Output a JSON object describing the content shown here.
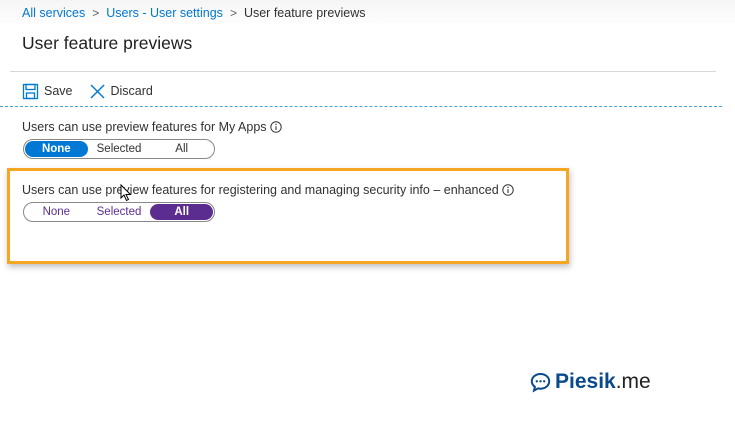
{
  "breadcrumb": {
    "items": [
      "All services",
      "Users - User settings",
      "User feature previews"
    ],
    "separator": ">"
  },
  "page": {
    "title": "User feature previews"
  },
  "toolbar": {
    "save_label": "Save",
    "discard_label": "Discard"
  },
  "settings": [
    {
      "label": "Users can use preview features for My Apps",
      "options": [
        "None",
        "Selected",
        "All"
      ],
      "selected": "None"
    },
    {
      "label": "Users can use preview features for registering and managing security info – enhanced",
      "options": [
        "None",
        "Selected",
        "All"
      ],
      "selected": "All"
    }
  ],
  "watermark": {
    "brand": "Piesik",
    "suffix": ".me"
  },
  "colors": {
    "link": "#0078d4",
    "toggle_selected_1": "#0078d4",
    "toggle_selected_2": "#5c2d91",
    "highlight": "#f5a623",
    "watermark": "#0a4a8c"
  },
  "icons": {
    "save": "save-icon",
    "discard": "close-icon",
    "info": "info-icon",
    "watermark": "chat-bubble-icon"
  }
}
